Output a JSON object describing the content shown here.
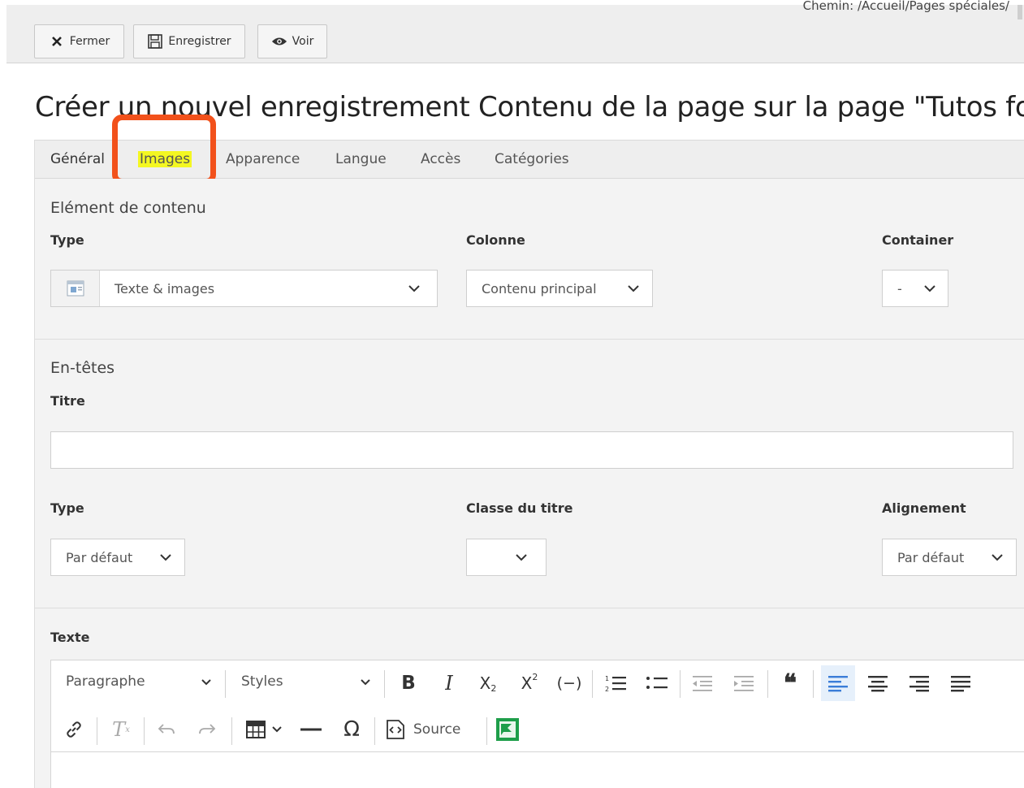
{
  "toolbar": {
    "breadcrumb": "Chemin: /Accueil/Pages spéciales/",
    "close_label": "Fermer",
    "save_label": "Enregistrer",
    "view_label": "Voir"
  },
  "page": {
    "title": "Créer un nouvel enregistrement Contenu de la page sur la page \"Tutos fo"
  },
  "tabs": [
    {
      "label": "Général"
    },
    {
      "label": "Images"
    },
    {
      "label": "Apparence"
    },
    {
      "label": "Langue"
    },
    {
      "label": "Accès"
    },
    {
      "label": "Catégories"
    }
  ],
  "content_element": {
    "section_title": "Elément de contenu",
    "type_label": "Type",
    "type_value": "Texte & images",
    "column_label": "Colonne",
    "column_value": "Contenu principal",
    "container_label": "Container",
    "container_value": "-"
  },
  "headers": {
    "section_title": "En-têtes",
    "title_label": "Titre",
    "title_value": "",
    "type_label": "Type",
    "type_value": "Par défaut",
    "class_label": "Classe du titre",
    "class_value": "",
    "align_label": "Alignement",
    "align_value": "Par défaut"
  },
  "text": {
    "label": "Texte",
    "format_value": "Paragraphe",
    "styles_value": "Styles",
    "source_label": "Source"
  },
  "colors": {
    "highlight": "#f4f722",
    "annotation": "#f2511b",
    "active_align": "#3b7dd8",
    "image_button": "#1e9e4a"
  }
}
